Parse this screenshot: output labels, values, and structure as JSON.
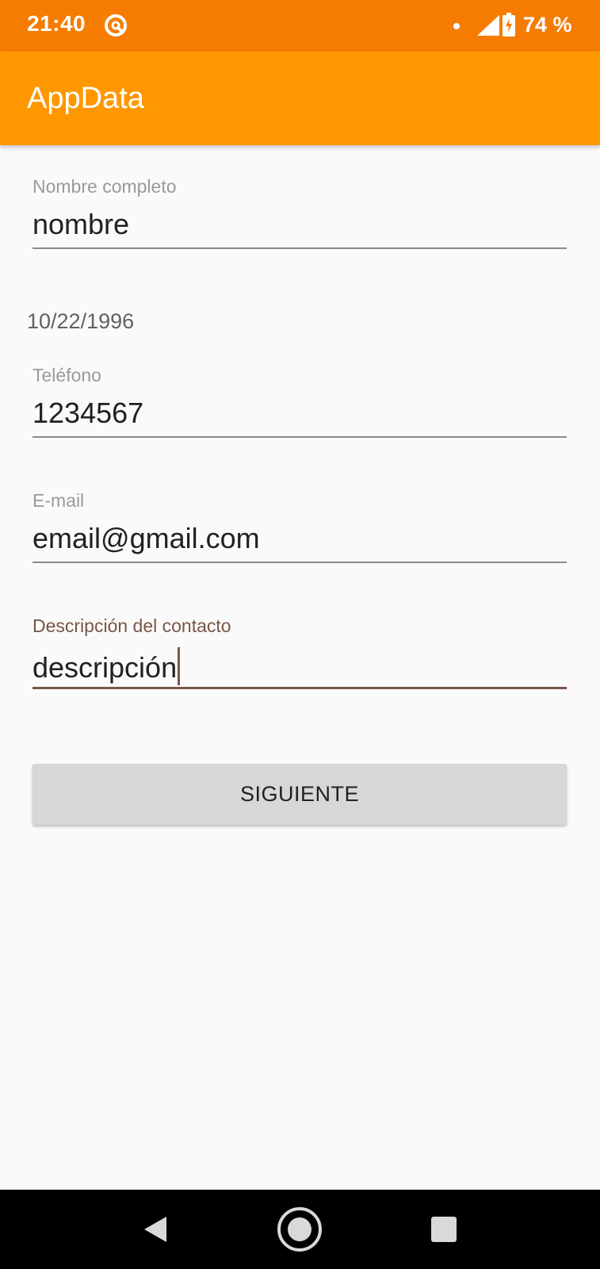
{
  "status_bar": {
    "time": "21:40",
    "battery": "74 %",
    "icons": [
      "app-notification-icon",
      "signal-icon",
      "battery-charging-icon"
    ]
  },
  "app_bar": {
    "title": "AppData"
  },
  "form": {
    "name": {
      "label": "Nombre completo",
      "value": "nombre"
    },
    "date": {
      "value": "10/22/1996"
    },
    "phone": {
      "label": "Teléfono",
      "value": "1234567"
    },
    "email": {
      "label": "E-mail",
      "value": "email@gmail.com"
    },
    "description": {
      "label": "Descripción del contacto",
      "value": "descripción"
    },
    "next_label": "SIGUIENTE"
  },
  "nav_bar": {
    "icons": [
      "back-icon",
      "home-icon",
      "recents-icon"
    ]
  },
  "colors": {
    "status_bar": "#f57c00",
    "app_bar": "#ff9800",
    "focused_field_accent": "#795548",
    "background": "#fafafa",
    "button": "#d6d7d7"
  }
}
